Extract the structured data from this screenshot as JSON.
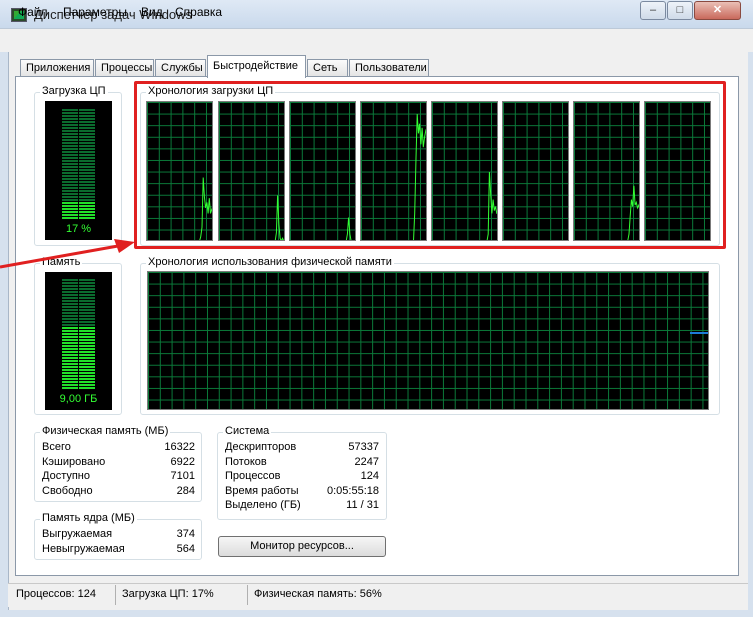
{
  "window": {
    "title": "Диспетчер задач Windows",
    "controls": {
      "minimize": "–",
      "maximize": "□",
      "close": "✕"
    }
  },
  "menu": [
    "Файл",
    "Параметры",
    "Вид",
    "Справка"
  ],
  "tabs": [
    "Приложения",
    "Процессы",
    "Службы",
    "Быстродействие",
    "Сеть",
    "Пользователи"
  ],
  "active_tab": "Быстродействие",
  "cpu_usage": {
    "title": "Загрузка ЦП",
    "value_label": "17 %",
    "fraction": 0.17
  },
  "cpu_history": {
    "title": "Хронология загрузки ЦП",
    "cores": [
      [
        0,
        0,
        0,
        0,
        0,
        0,
        0,
        0,
        0,
        0,
        0,
        0,
        0,
        0,
        0,
        0,
        0,
        0,
        0,
        0,
        0,
        0,
        0,
        0,
        0,
        0,
        0,
        0,
        0,
        0,
        0,
        0,
        0,
        0,
        0,
        0,
        0,
        0,
        0,
        0,
        0,
        0,
        0,
        0.03,
        0.1,
        0.46,
        0.32,
        0.24,
        0.28,
        0.2,
        0.31,
        0.2,
        0.23,
        0.25
      ],
      [
        0,
        0,
        0,
        0,
        0,
        0,
        0,
        0,
        0,
        0,
        0,
        0,
        0,
        0,
        0,
        0,
        0,
        0,
        0,
        0,
        0,
        0,
        0,
        0,
        0,
        0,
        0,
        0,
        0,
        0,
        0,
        0,
        0,
        0,
        0,
        0,
        0,
        0,
        0,
        0,
        0,
        0,
        0,
        0,
        0,
        0,
        0.06,
        0.33,
        0.12,
        0.02,
        0.0,
        0.02,
        0.0,
        0.0
      ],
      [
        0,
        0,
        0,
        0,
        0,
        0,
        0,
        0,
        0,
        0,
        0,
        0,
        0,
        0,
        0,
        0,
        0,
        0,
        0,
        0,
        0,
        0,
        0,
        0,
        0,
        0,
        0,
        0,
        0,
        0,
        0,
        0,
        0,
        0,
        0,
        0,
        0,
        0,
        0,
        0,
        0,
        0,
        0,
        0,
        0,
        0,
        0.05,
        0.17,
        0.05,
        0.0,
        0.0,
        0.0,
        0.0,
        0.0
      ],
      [
        0,
        0,
        0,
        0,
        0,
        0,
        0,
        0,
        0,
        0,
        0,
        0,
        0,
        0,
        0,
        0,
        0,
        0,
        0,
        0,
        0,
        0,
        0,
        0,
        0,
        0,
        0,
        0,
        0,
        0,
        0,
        0,
        0,
        0,
        0,
        0,
        0,
        0,
        0,
        0,
        0,
        0,
        0,
        0.2,
        0.6,
        0.92,
        0.78,
        0.85,
        0.7,
        0.82,
        0.68,
        0.75,
        0.8,
        0.78
      ],
      [
        0,
        0,
        0,
        0,
        0,
        0,
        0,
        0,
        0,
        0,
        0,
        0,
        0,
        0,
        0,
        0,
        0,
        0,
        0,
        0,
        0,
        0,
        0,
        0,
        0,
        0,
        0,
        0,
        0,
        0,
        0,
        0,
        0,
        0,
        0,
        0,
        0,
        0,
        0,
        0,
        0,
        0,
        0,
        0,
        0,
        0.05,
        0.5,
        0.35,
        0.2,
        0.3,
        0.22,
        0.25,
        0.2,
        0.2
      ],
      [
        0,
        0,
        0,
        0,
        0,
        0,
        0,
        0,
        0,
        0,
        0,
        0,
        0,
        0,
        0,
        0,
        0,
        0,
        0,
        0,
        0,
        0,
        0,
        0,
        0,
        0,
        0,
        0,
        0,
        0,
        0,
        0,
        0,
        0,
        0,
        0,
        0,
        0,
        0,
        0,
        0,
        0,
        0,
        0,
        0,
        0,
        0,
        0,
        0,
        0,
        0,
        0,
        0,
        0
      ],
      [
        0,
        0,
        0,
        0,
        0,
        0,
        0,
        0,
        0,
        0,
        0,
        0,
        0,
        0,
        0,
        0,
        0,
        0,
        0,
        0,
        0,
        0,
        0,
        0,
        0,
        0,
        0,
        0,
        0,
        0,
        0,
        0,
        0,
        0,
        0,
        0,
        0,
        0,
        0,
        0,
        0,
        0,
        0,
        0,
        0.05,
        0.18,
        0.3,
        0.25,
        0.4,
        0.26,
        0.28,
        0.24,
        0.26,
        0.22
      ],
      [
        0,
        0,
        0,
        0,
        0,
        0,
        0,
        0,
        0,
        0,
        0,
        0,
        0,
        0,
        0,
        0,
        0,
        0,
        0,
        0,
        0,
        0,
        0,
        0,
        0,
        0,
        0,
        0,
        0,
        0,
        0,
        0,
        0,
        0,
        0,
        0,
        0,
        0,
        0,
        0,
        0,
        0,
        0,
        0,
        0,
        0,
        0,
        0,
        0,
        0,
        0,
        0,
        0,
        0
      ]
    ]
  },
  "memory_usage": {
    "title": "Память",
    "value_label": "9,00 ГБ",
    "fraction": 0.56
  },
  "memory_history": {
    "title": "Хронология использования физической памяти",
    "current_fraction": 0.56
  },
  "physical_memory": {
    "title": "Физическая память (МБ)",
    "rows": [
      {
        "label": "Всего",
        "value": "16322"
      },
      {
        "label": "Кэшировано",
        "value": "6922"
      },
      {
        "label": "Доступно",
        "value": "7101"
      },
      {
        "label": "Свободно",
        "value": "284"
      }
    ]
  },
  "kernel_memory": {
    "title": "Память ядра (МБ)",
    "rows": [
      {
        "label": "Выгружаемая",
        "value": "374"
      },
      {
        "label": "Невыгружаемая",
        "value": "564"
      }
    ]
  },
  "system": {
    "title": "Система",
    "rows": [
      {
        "label": "Дескрипторов",
        "value": "57337"
      },
      {
        "label": "Потоков",
        "value": "2247"
      },
      {
        "label": "Процессов",
        "value": "124"
      },
      {
        "label": "Время работы",
        "value": "0:05:55:18"
      },
      {
        "label": "Выделено (ГБ)",
        "value": "11 / 31"
      }
    ]
  },
  "resource_monitor_button": "Монитор ресурсов...",
  "status": {
    "processes": "Процессов: 124",
    "cpu": "Загрузка ЦП: 17%",
    "memory": "Физическая память: 56%"
  },
  "colors": {
    "graph_line": "#33ff33",
    "grid": "#0b7b3a",
    "annotation": "#e02020",
    "memory_marker": "#1e7bd8"
  }
}
